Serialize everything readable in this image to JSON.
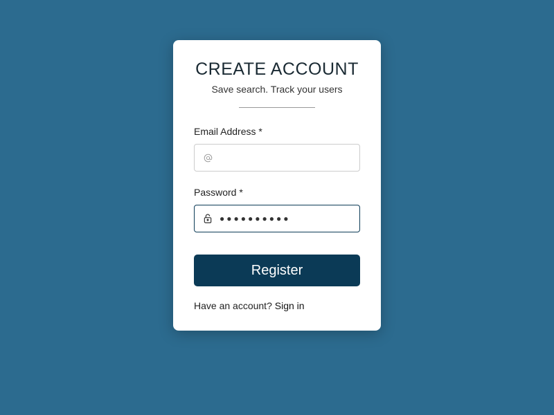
{
  "card": {
    "title": "CREATE ACCOUNT",
    "subtitle": "Save search. Track your users"
  },
  "fields": {
    "email": {
      "label": "Email Address *",
      "value": "",
      "placeholder": ""
    },
    "password": {
      "label": "Password *",
      "masked_display": "●●●●●●●●●●"
    }
  },
  "buttons": {
    "register": "Register"
  },
  "footer": {
    "prompt": "Have an account? ",
    "link": "Sign in"
  }
}
